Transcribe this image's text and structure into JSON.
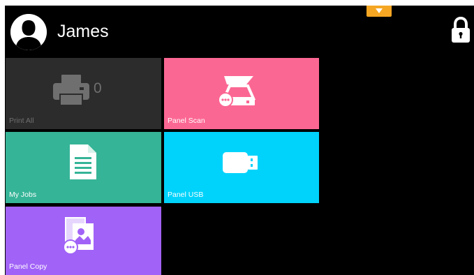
{
  "header": {
    "user_name": "James",
    "avatar_icon": "user-avatar-icon",
    "dropdown_icon": "chevron-down-icon",
    "lock_icon": "lock-icon"
  },
  "tiles": [
    {
      "label": "Print All",
      "count": "0",
      "icon": "printer-icon",
      "color": "#2c2c2c"
    },
    {
      "label": "Panel Scan",
      "icon": "scanner-icon",
      "color": "#fb6793"
    },
    {
      "label": "My Jobs",
      "icon": "document-icon",
      "color": "#35b497"
    },
    {
      "label": "Panel USB",
      "icon": "usb-drive-icon",
      "color": "#00d3fb"
    },
    {
      "label": "Panel Copy",
      "icon": "copy-icon",
      "color": "#a162f7"
    }
  ],
  "colors": {
    "background": "#000000",
    "accent": "#f5a623"
  }
}
